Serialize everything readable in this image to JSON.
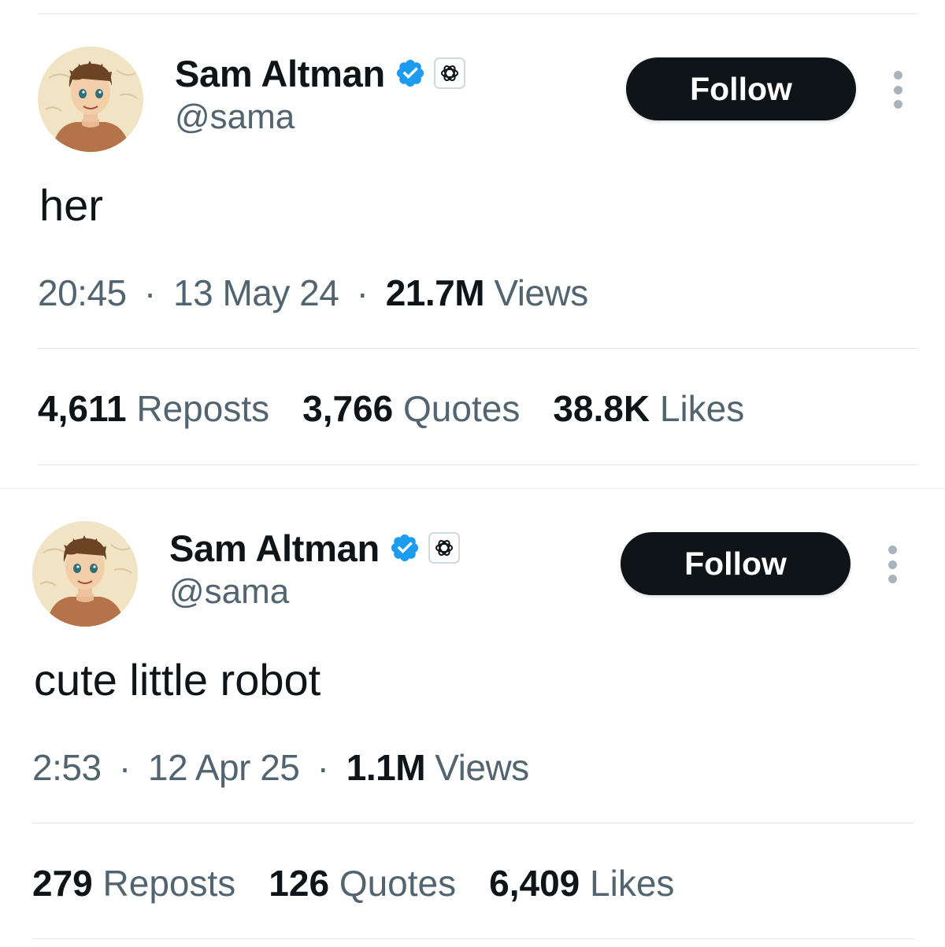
{
  "posts": [
    {
      "author": {
        "display_name": "Sam Altman",
        "handle": "@sama",
        "verified_icon": "verified-badge-icon",
        "org_icon": "openai-logo-icon",
        "avatar": "anime-style-portrait"
      },
      "follow_label": "Follow",
      "more_icon": "more-options-icon",
      "text": "her",
      "time": "20:45",
      "date": "13 May 24",
      "views_count": "21.7M",
      "views_label": "Views",
      "stats": {
        "reposts_count": "4,611",
        "reposts_label": "Reposts",
        "quotes_count": "3,766",
        "quotes_label": "Quotes",
        "likes_count": "38.8K",
        "likes_label": "Likes"
      }
    },
    {
      "author": {
        "display_name": "Sam Altman",
        "handle": "@sama",
        "verified_icon": "verified-badge-icon",
        "org_icon": "openai-logo-icon",
        "avatar": "anime-style-portrait"
      },
      "follow_label": "Follow",
      "more_icon": "more-options-icon",
      "text": "cute little robot",
      "time": "2:53",
      "date": "12 Apr 25",
      "views_count": "1.1M",
      "views_label": "Views",
      "stats": {
        "reposts_count": "279",
        "reposts_label": "Reposts",
        "quotes_count": "126",
        "quotes_label": "Quotes",
        "likes_count": "6,409",
        "likes_label": "Likes"
      }
    }
  ],
  "colors": {
    "text_primary": "#0f1419",
    "text_secondary": "#536471",
    "verified_blue": "#1d9bf0",
    "follow_bg": "#0f1419",
    "divider": "#e1e5e9"
  },
  "separator": "·"
}
